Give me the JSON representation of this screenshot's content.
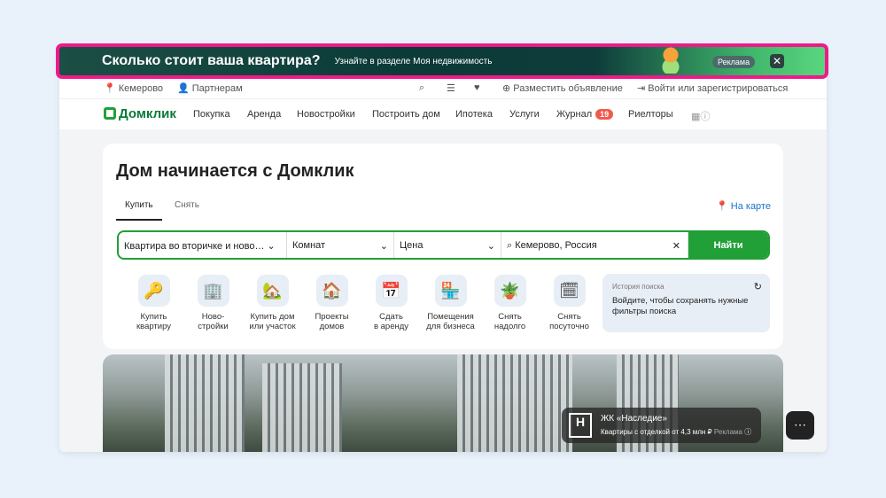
{
  "ad": {
    "title": "Сколько стоит ваша квартира?",
    "subtitle": "Узнайте в разделе Моя недвижимость",
    "badge": "Реклама",
    "close": "✕"
  },
  "topbar": {
    "city": "Кемерово",
    "partners": "Партнерам",
    "post": "Разместить объявление",
    "login": "Войти или зарегистрироваться"
  },
  "nav": {
    "logo": "Домклик",
    "items": [
      "Покупка",
      "Аренда",
      "Новостройки",
      "Построить дом",
      "Ипотека",
      "Услуги",
      "Журнал",
      "Риелторы"
    ],
    "journal_count": "19"
  },
  "main": {
    "title": "Дом начинается с Домклик",
    "tabs": [
      "Купить",
      "Снять"
    ],
    "map_link": "На карте",
    "search": {
      "type": "Квартира во вторичке и ново…",
      "rooms": "Комнат",
      "price": "Цена",
      "location": "Кемерово, Россия",
      "button": "Найти"
    },
    "categories": [
      {
        "l1": "Купить",
        "l2": "квартиру",
        "icon": "🔑"
      },
      {
        "l1": "Ново-",
        "l2": "стройки",
        "icon": "🏢"
      },
      {
        "l1": "Купить дом",
        "l2": "или участок",
        "icon": "🏡"
      },
      {
        "l1": "Проекты",
        "l2": "домов",
        "icon": "🏠"
      },
      {
        "l1": "Сдать",
        "l2": "в аренду",
        "icon": "📅"
      },
      {
        "l1": "Помещения",
        "l2": "для бизнеса",
        "icon": "🏪"
      },
      {
        "l1": "Снять",
        "l2": "надолго",
        "icon": "🪴"
      },
      {
        "l1": "Снять",
        "l2": "посуточно",
        "icon": "🗓"
      }
    ],
    "history": {
      "title": "История поиска",
      "message": "Войдите, чтобы сохранять нужные фильтры поиска"
    }
  },
  "promo": {
    "name": "ЖК «Наследие»",
    "desc": "Квартиры с отделкой от 4,3 млн ₽",
    "ad": "Реклама",
    "logo_text": "ЖК НАСЛЕДИЕ"
  }
}
